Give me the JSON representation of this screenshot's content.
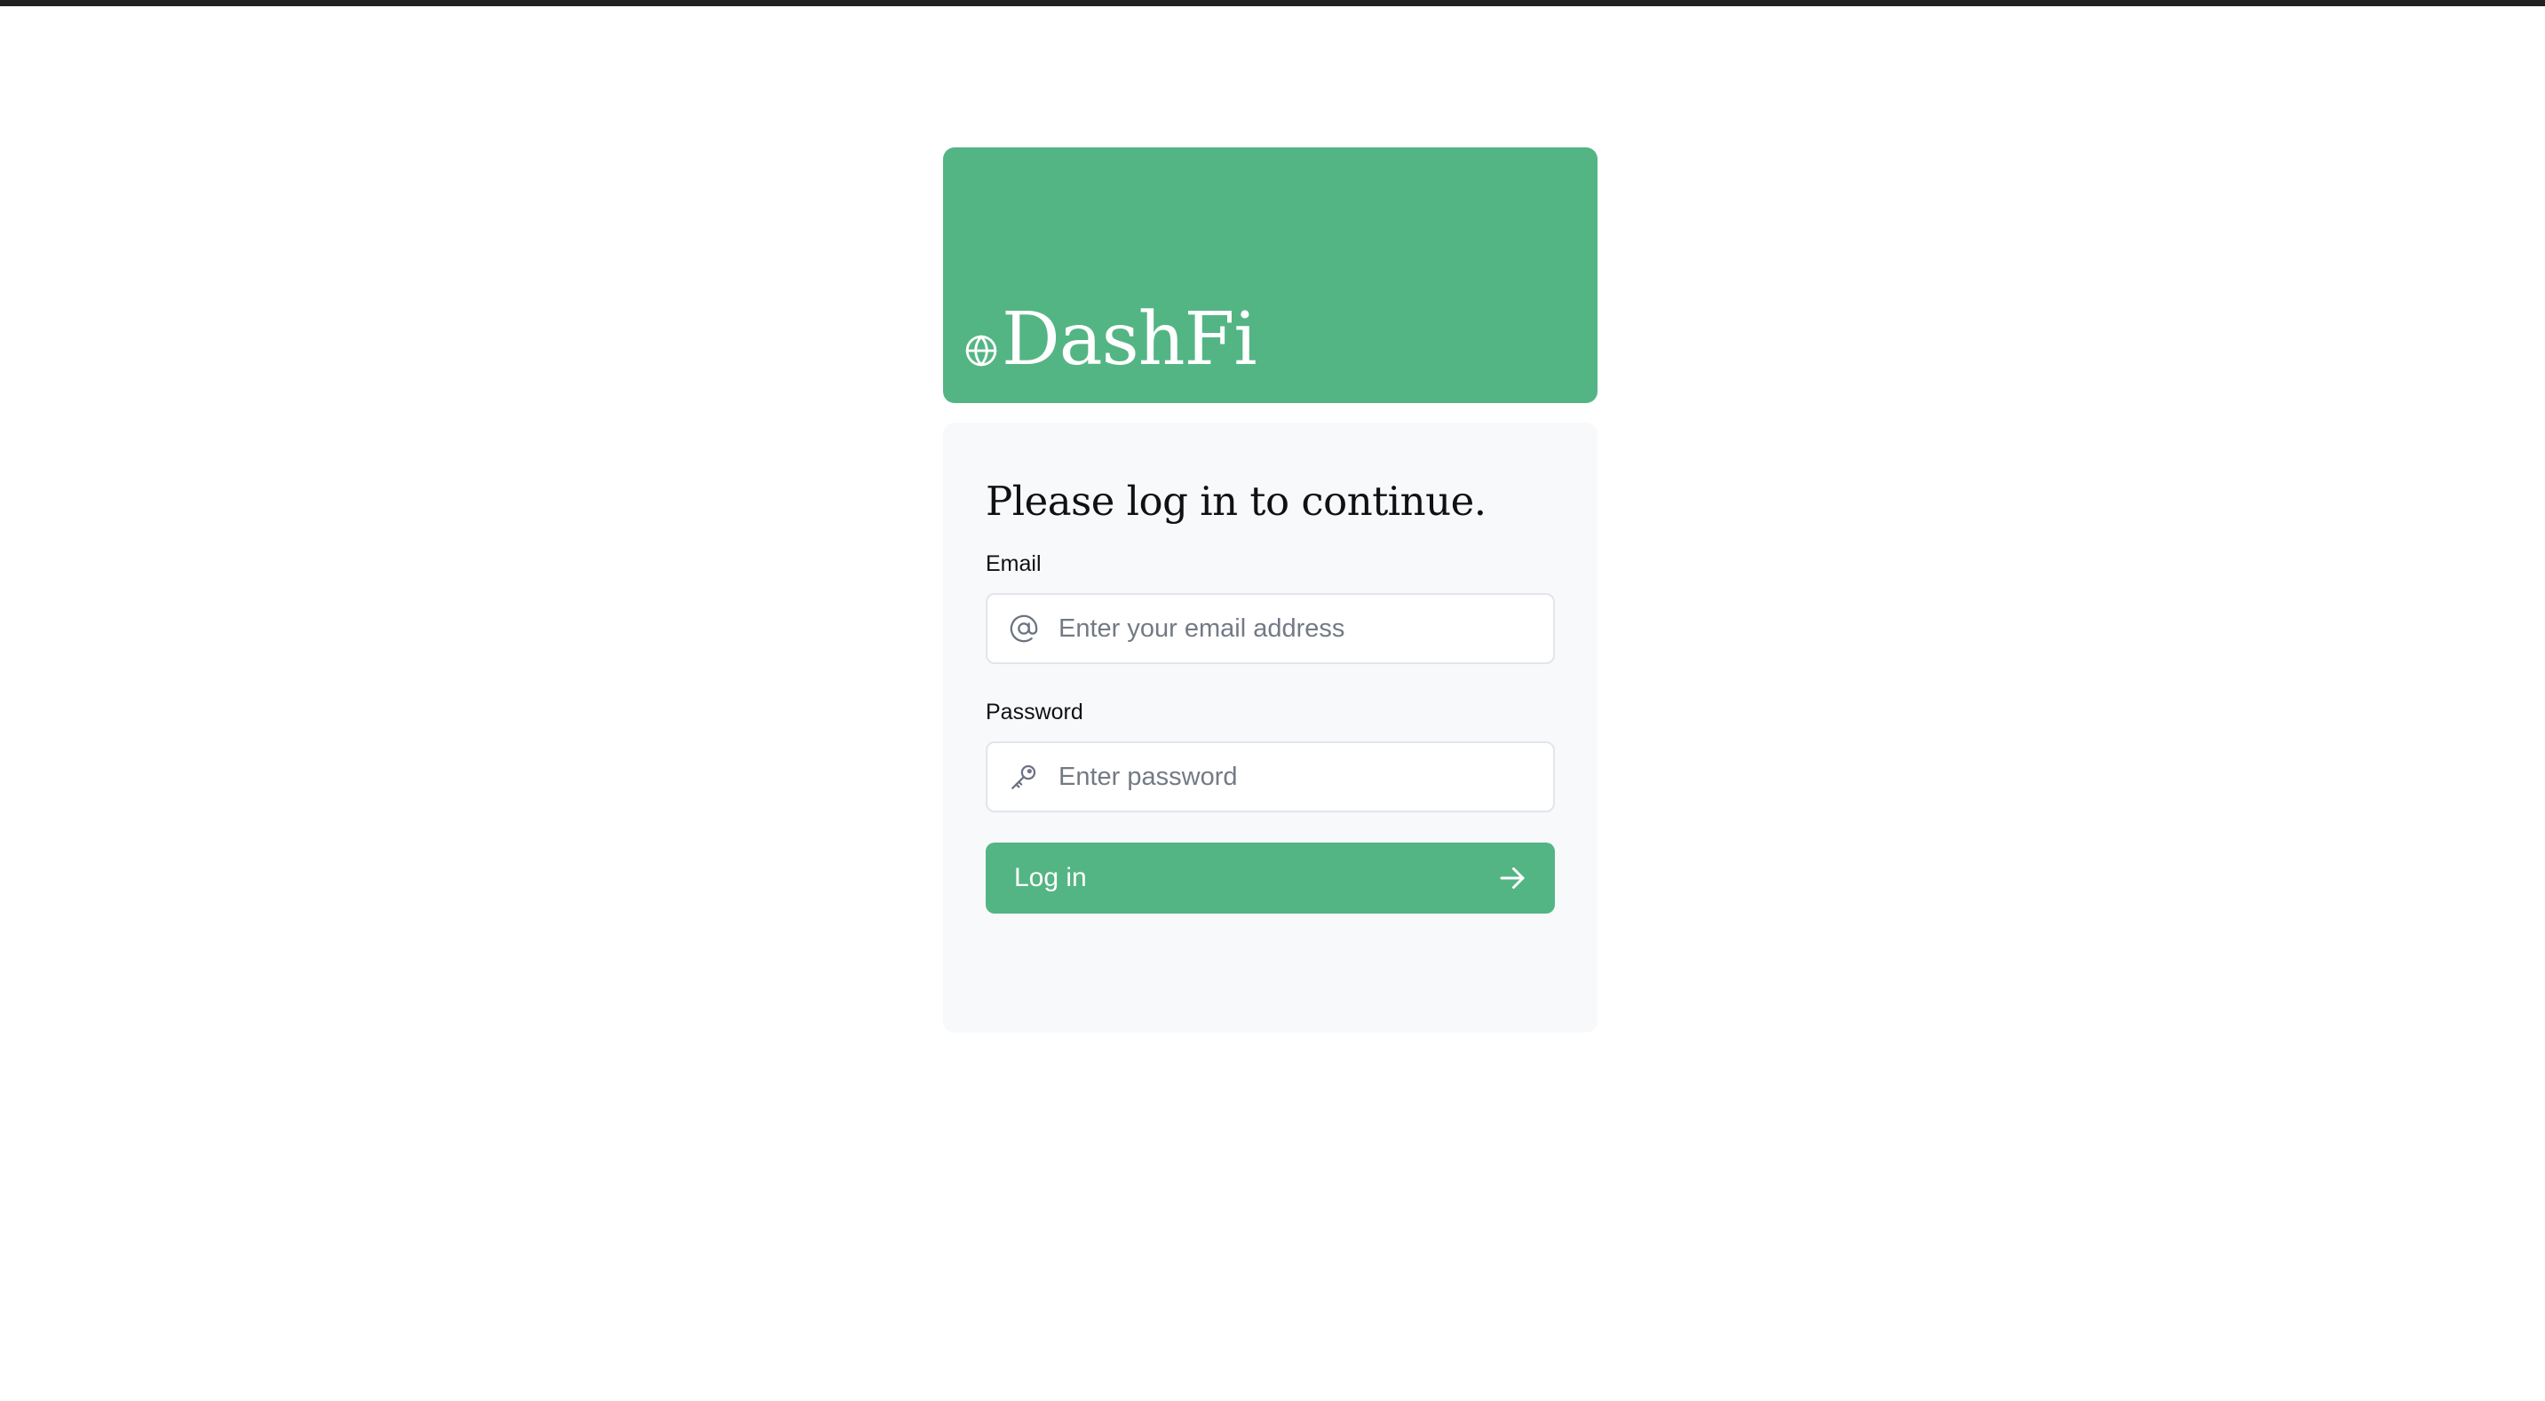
{
  "brand": {
    "name": "DashFi",
    "icon": "globe-icon"
  },
  "login": {
    "heading": "Please log in to continue.",
    "email": {
      "label": "Email",
      "placeholder": "Enter your email address",
      "value": "",
      "icon": "at-sign-icon"
    },
    "password": {
      "label": "Password",
      "placeholder": "Enter password",
      "value": "",
      "icon": "key-icon"
    },
    "button": {
      "label": "Log in",
      "icon": "arrow-right-icon"
    }
  },
  "colors": {
    "accent": "#54b584",
    "card_background": "#f8f9fb",
    "top_bar": "#212121"
  }
}
